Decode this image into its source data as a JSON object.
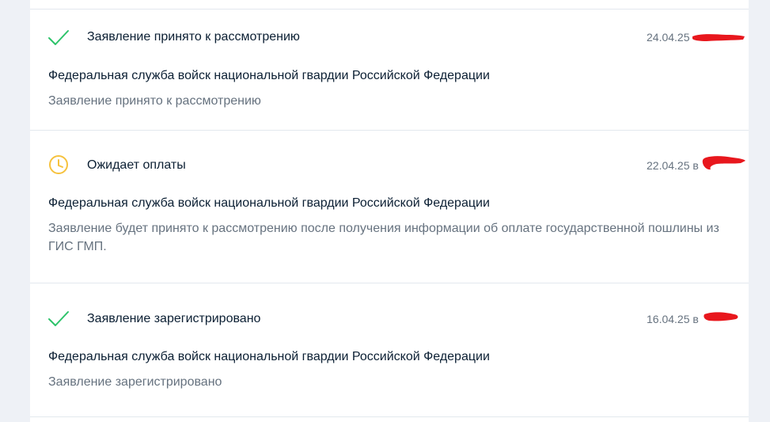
{
  "history": {
    "events": [
      {
        "status_icon": "check-icon",
        "title": "Заявление принято к рассмотрению",
        "date": "24.04.25",
        "organization": "Федеральная служба войск национальной гвардии Российской Федерации",
        "description": "Заявление принято к рассмотрению"
      },
      {
        "status_icon": "clock-icon",
        "title": "Ожидает оплаты",
        "date": "22.04.25 в",
        "organization": "Федеральная служба войск национальной гвардии Российской Федерации",
        "description": "Заявление будет принято к рассмотрению после получения информации об оплате государственной пошлины из ГИС ГМП."
      },
      {
        "status_icon": "check-icon",
        "title": "Заявление зарегистрировано",
        "date": "16.04.25 в",
        "organization": "Федеральная служба войск национальной гвардии Российской Федерации",
        "description": "Заявление зарегистрировано"
      }
    ]
  },
  "colors": {
    "success": "#2dc36a",
    "warning": "#f6c23e",
    "redaction": "#e8171d",
    "text_primary": "#0b1f33",
    "text_secondary": "#66727f"
  }
}
